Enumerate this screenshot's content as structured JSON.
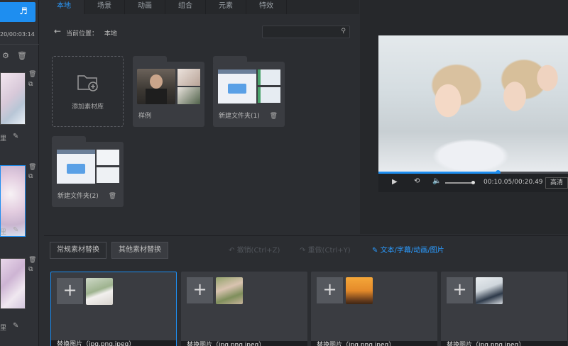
{
  "sidebar": {
    "time_label": "20/00:03:14",
    "labels": [
      "里",
      "里",
      "里"
    ]
  },
  "tabs": [
    "本地",
    "场景",
    "动画",
    "组合",
    "元素",
    "特效"
  ],
  "location": {
    "label": "当前位置：",
    "value": "本地"
  },
  "library": {
    "add_label": "添加素材库",
    "folders": [
      {
        "name": "样例"
      },
      {
        "name": "新建文件夹(1)"
      },
      {
        "name": "新建文件夹(2)"
      }
    ]
  },
  "player": {
    "timecode": "00:10.05/00:20.49",
    "quality": "高清",
    "progress": 0.63
  },
  "bottom": {
    "tabs": [
      "常规素材替换",
      "其他素材替换"
    ],
    "undo": "撤销(Ctrl+Z)",
    "redo": "重做(Ctrl+Y)",
    "text_link": "文本/字幕/动画/图片",
    "slot_caption": "替换图片（jpg,png,jpeg）",
    "slots": 4
  },
  "colors": {
    "accent": "#1e8ef0",
    "panel": "#2b2d31",
    "card": "#3a3c41"
  }
}
